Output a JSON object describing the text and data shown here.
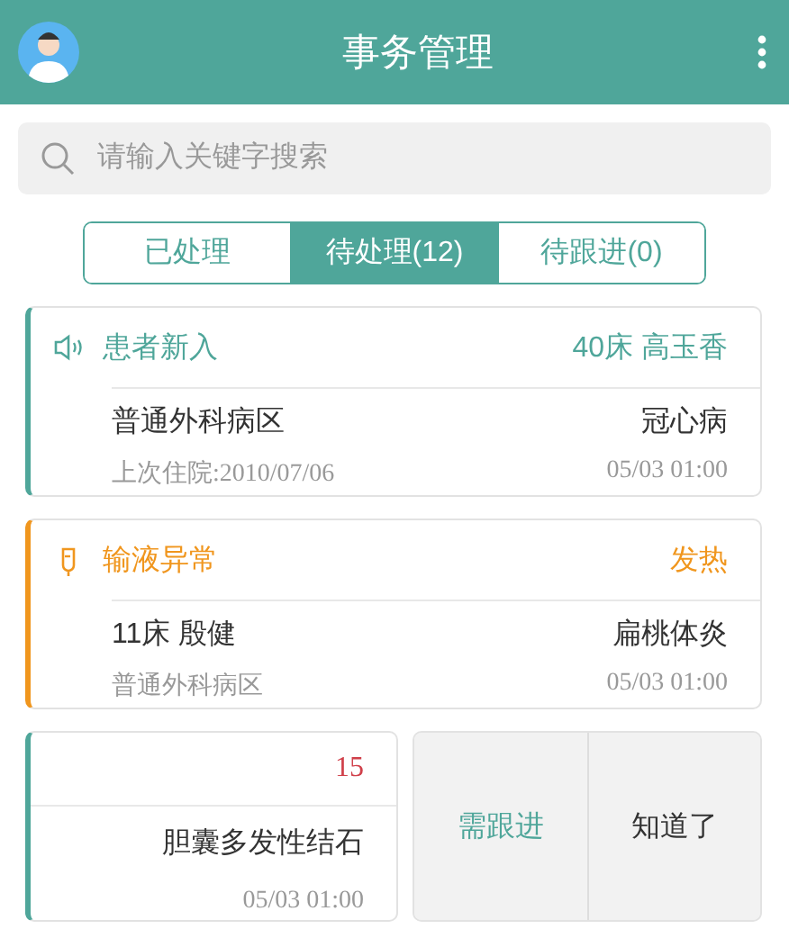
{
  "header": {
    "title": "事务管理"
  },
  "search": {
    "placeholder": "请输入关键字搜索"
  },
  "tabs": [
    {
      "label": "已处理",
      "selected": false
    },
    {
      "label": "待处理(12)",
      "selected": true
    },
    {
      "label": "待跟进(0)",
      "selected": false
    }
  ],
  "cards": [
    {
      "kind": "new_patient",
      "color": "#4fa69a",
      "title": "患者新入",
      "tag": "40床 高玉香",
      "line_left": "普通外科病区",
      "line_right": "冠心病",
      "meta": "上次住院:2010/07/06",
      "time": "05/03 01:00"
    },
    {
      "kind": "infusion",
      "color": "#f0961e",
      "title": "输液异常",
      "tag": "发热",
      "line_left": "11床 殷健",
      "line_right": "扁桃体炎",
      "meta": "普通外科病区",
      "time": "05/03 01:00"
    },
    {
      "kind": "swiped",
      "color": "#4fa69a",
      "tag": "15",
      "line_right": "胆囊多发性结石",
      "time": "05/03 01:00",
      "actions": [
        {
          "label": "需跟进",
          "kind": "follow"
        },
        {
          "label": "知道了",
          "kind": "ack"
        }
      ]
    }
  ]
}
